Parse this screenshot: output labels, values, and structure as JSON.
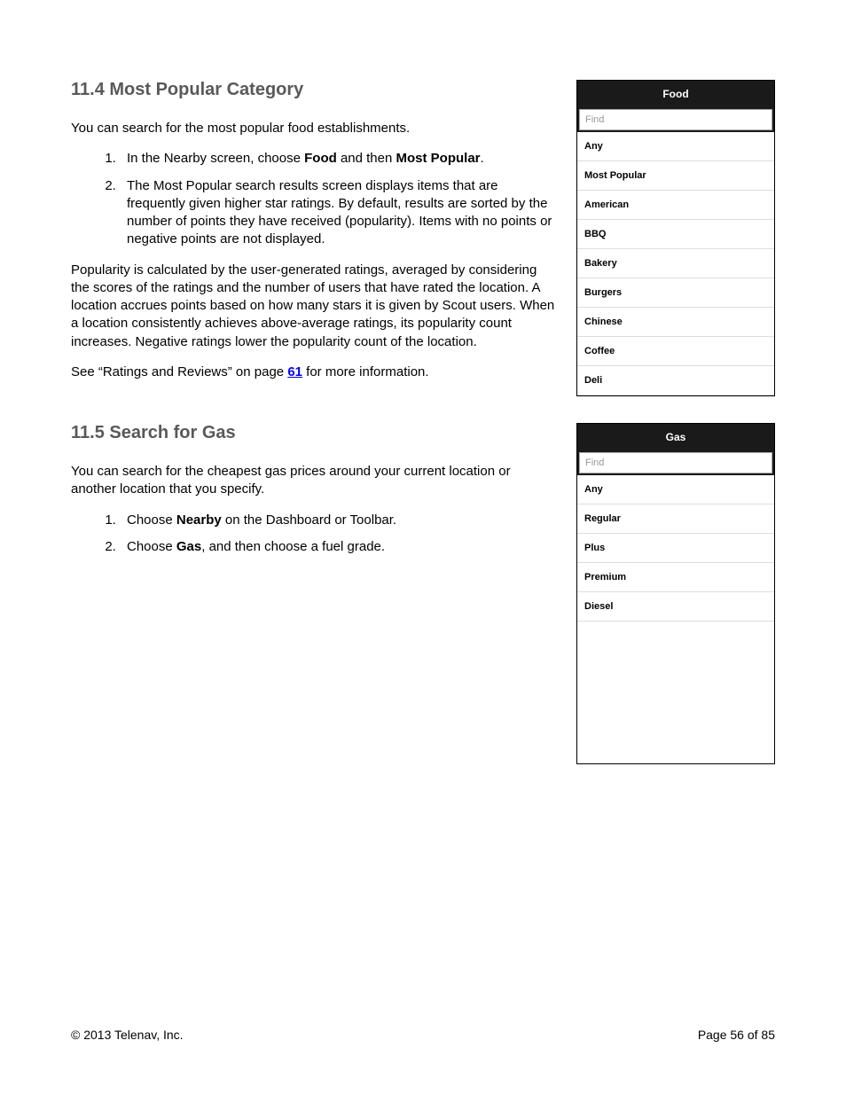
{
  "section1": {
    "heading": "11.4 Most Popular Category",
    "intro": "You can search for the most popular food establishments.",
    "step1_pre": "In the Nearby screen, choose ",
    "step1_b1": "Food",
    "step1_mid": " and then ",
    "step1_b2": "Most Popular",
    "step1_post": ".",
    "step2": "The Most Popular search results screen displays items that are frequently given higher star ratings. By default, results are sorted by the number of points they have received (popularity). Items with no points or negative points are not displayed.",
    "para2": "Popularity is calculated by the user-generated ratings, averaged by considering the scores of the ratings and the number of users that have rated the location. A location accrues points based on how many stars it is given by Scout users. When a location consistently achieves above-average ratings, its popularity count increases. Negative ratings lower the popularity count of the location.",
    "see_pre": "See “Ratings and Reviews” on page ",
    "see_link": "61",
    "see_post": " for more information."
  },
  "phone1": {
    "title": "Food",
    "placeholder": "Find",
    "items": [
      "Any",
      "Most Popular",
      "American",
      "BBQ",
      "Bakery",
      "Burgers",
      "Chinese",
      "Coffee",
      "Deli"
    ]
  },
  "section2": {
    "heading": "11.5 Search for Gas",
    "intro": "You can search for the cheapest gas prices around your current location or another location that you specify.",
    "step1_pre": "Choose ",
    "step1_b1": "Nearby",
    "step1_post": " on the Dashboard or Toolbar.",
    "step2_pre": "Choose ",
    "step2_b1": "Gas",
    "step2_post": ", and then choose a fuel grade."
  },
  "phone2": {
    "title": "Gas",
    "placeholder": "Find",
    "items": [
      "Any",
      "Regular",
      "Plus",
      "Premium",
      "Diesel"
    ]
  },
  "footer": {
    "copyright": "© 2013 Telenav, Inc.",
    "page": "Page 56 of 85"
  }
}
